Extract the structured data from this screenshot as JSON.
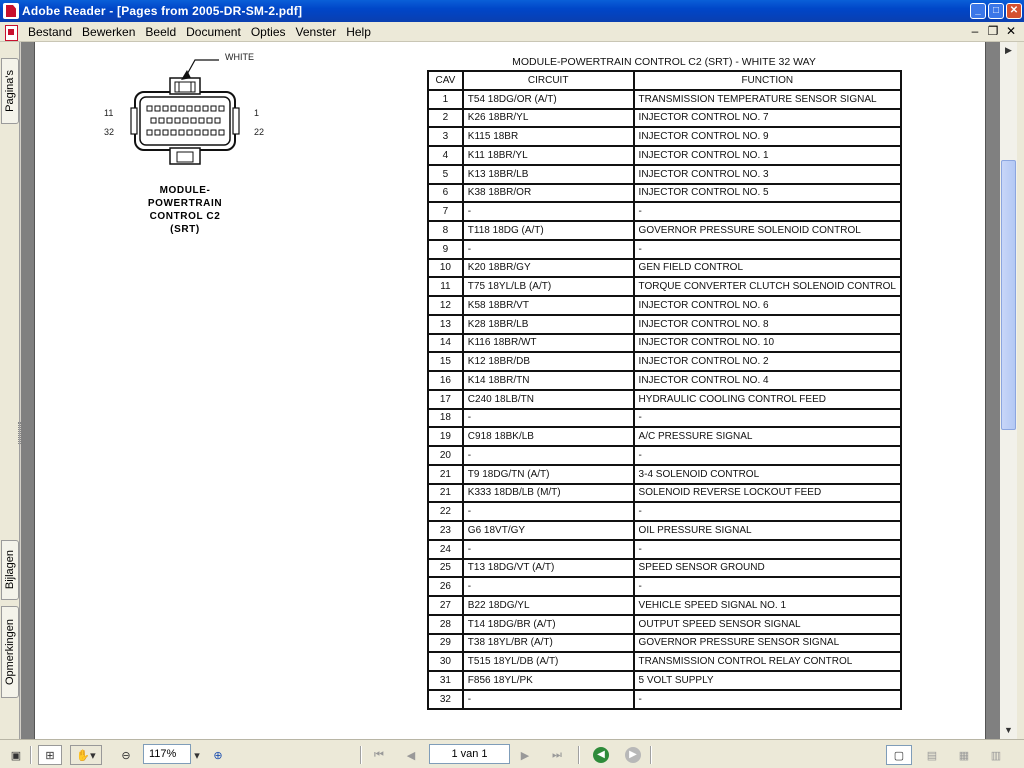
{
  "window": {
    "title": "Adobe Reader - [Pages from 2005-DR-SM-2.pdf]",
    "min": "_",
    "max": "□",
    "close": "✕"
  },
  "menu": [
    "Bestand",
    "Bewerken",
    "Beeld",
    "Document",
    "Opties",
    "Venster",
    "Help"
  ],
  "mdi": {
    "min": "–",
    "restore": "❐",
    "close": "✕"
  },
  "side_tabs": {
    "pages": "Pagina's",
    "attachments": "Bijlagen",
    "comments": "Opmerkingen"
  },
  "connector": {
    "wire_color": "WHITE",
    "pin_11": "11",
    "pin_1": "1",
    "pin_32": "32",
    "pin_22": "22",
    "module_lines": [
      "MODULE-",
      "POWERTRAIN",
      "CONTROL C2",
      "(SRT)"
    ]
  },
  "table": {
    "title": "MODULE-POWERTRAIN CONTROL C2 (SRT) - WHITE 32 WAY",
    "headers": [
      "CAV",
      "CIRCUIT",
      "FUNCTION"
    ],
    "rows": [
      [
        "1",
        "T54 18DG/OR (A/T)",
        "TRANSMISSION TEMPERATURE SENSOR SIGNAL"
      ],
      [
        "2",
        "K26 18BR/YL",
        "INJECTOR CONTROL NO. 7"
      ],
      [
        "3",
        "K115 18BR",
        "INJECTOR CONTROL NO. 9"
      ],
      [
        "4",
        "K11 18BR/YL",
        "INJECTOR CONTROL NO. 1"
      ],
      [
        "5",
        "K13 18BR/LB",
        "INJECTOR CONTROL NO. 3"
      ],
      [
        "6",
        "K38 18BR/OR",
        "INJECTOR CONTROL NO. 5"
      ],
      [
        "7",
        "-",
        "-"
      ],
      [
        "8",
        "T118 18DG (A/T)",
        "GOVERNOR PRESSURE SOLENOID CONTROL"
      ],
      [
        "9",
        "-",
        "-"
      ],
      [
        "10",
        "K20 18BR/GY",
        "GEN FIELD CONTROL"
      ],
      [
        "11",
        "T75 18YL/LB (A/T)",
        "TORQUE CONVERTER CLUTCH SOLENOID CONTROL"
      ],
      [
        "12",
        "K58 18BR/VT",
        "INJECTOR CONTROL NO. 6"
      ],
      [
        "13",
        "K28 18BR/LB",
        "INJECTOR CONTROL NO. 8"
      ],
      [
        "14",
        "K116 18BR/WT",
        "INJECTOR CONTROL NO. 10"
      ],
      [
        "15",
        "K12 18BR/DB",
        "INJECTOR CONTROL NO. 2"
      ],
      [
        "16",
        "K14 18BR/TN",
        "INJECTOR CONTROL NO. 4"
      ],
      [
        "17",
        "C240 18LB/TN",
        "HYDRAULIC COOLING CONTROL FEED"
      ],
      [
        "18",
        "-",
        "-"
      ],
      [
        "19",
        "C918 18BK/LB",
        "A/C PRESSURE SIGNAL"
      ],
      [
        "20",
        "-",
        "-"
      ],
      [
        "21",
        "T9 18DG/TN (A/T)",
        "3-4 SOLENOID CONTROL"
      ],
      [
        "21",
        "K333 18DB/LB (M/T)",
        "SOLENOID REVERSE LOCKOUT FEED"
      ],
      [
        "22",
        "-",
        "-"
      ],
      [
        "23",
        "G6 18VT/GY",
        "OIL PRESSURE SIGNAL"
      ],
      [
        "24",
        "-",
        "-"
      ],
      [
        "25",
        "T13 18DG/VT (A/T)",
        "SPEED SENSOR GROUND"
      ],
      [
        "26",
        "-",
        "-"
      ],
      [
        "27",
        "B22 18DG/YL",
        "VEHICLE SPEED SIGNAL NO. 1"
      ],
      [
        "28",
        "T14 18DG/BR (A/T)",
        "OUTPUT SPEED SENSOR SIGNAL"
      ],
      [
        "29",
        "T38 18YL/BR (A/T)",
        "GOVERNOR PRESSURE SENSOR SIGNAL"
      ],
      [
        "30",
        "T515 18YL/DB (A/T)",
        "TRANSMISSION CONTROL RELAY CONTROL"
      ],
      [
        "31",
        "F856 18YL/PK",
        "5 VOLT SUPPLY"
      ],
      [
        "32",
        "-",
        "-"
      ]
    ]
  },
  "toolbar": {
    "zoom": "117%",
    "page_indicator": "1 van 1"
  },
  "colors": {
    "titlebar": "#0046c8",
    "back_green": "#2e8b3a",
    "chrome": "#ece9d8"
  }
}
